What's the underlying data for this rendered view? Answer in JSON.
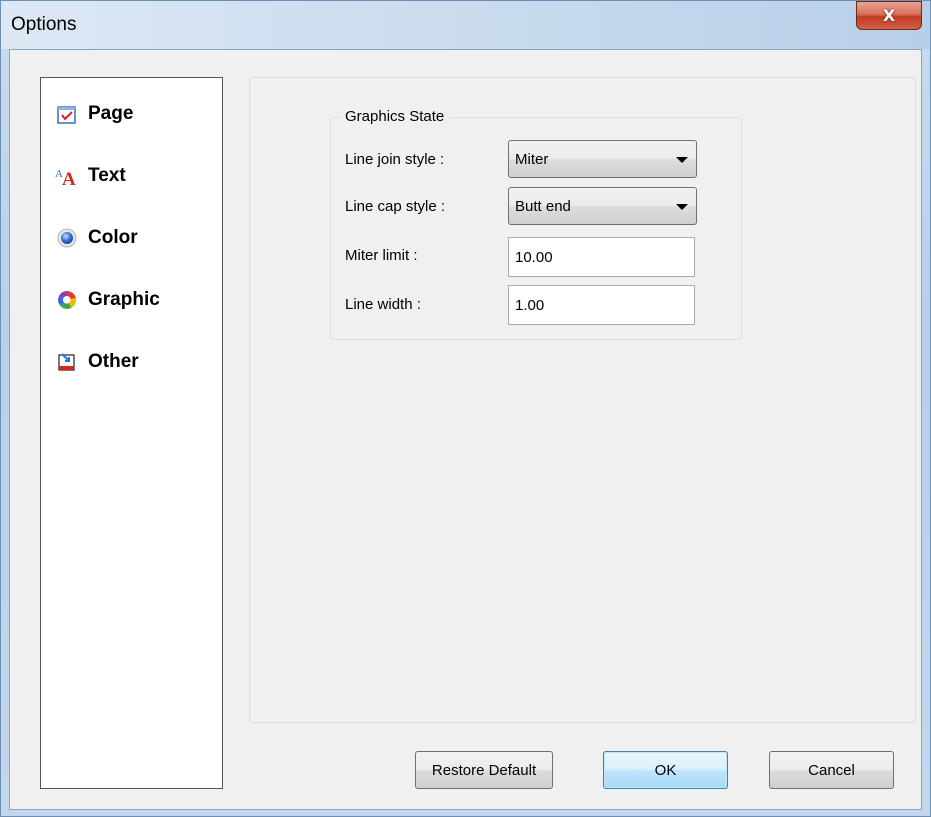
{
  "window": {
    "title": "Options",
    "close_label": "X"
  },
  "sidebar": {
    "items": [
      {
        "label": "Page",
        "icon": "page-icon"
      },
      {
        "label": "Text",
        "icon": "text-icon"
      },
      {
        "label": "Color",
        "icon": "color-icon"
      },
      {
        "label": "Graphic",
        "icon": "graphic-icon"
      },
      {
        "label": "Other",
        "icon": "other-icon"
      }
    ],
    "text_icon_glyph": "A",
    "text_icon_glyph_small": "A"
  },
  "graphics_state": {
    "title": "Graphics State",
    "line_join_label": "Line join style :",
    "line_join_value": "Miter",
    "line_cap_label": "Line cap style :",
    "line_cap_value": "Butt end",
    "miter_limit_label": "Miter limit :",
    "miter_limit_value": "10.00",
    "line_width_label": "Line width :",
    "line_width_value": "1.00"
  },
  "buttons": {
    "restore_default": "Restore Default",
    "ok": "OK",
    "cancel": "Cancel"
  },
  "colors": {
    "titlebar": "#c9dbef",
    "close_button": "#c23b1f",
    "panel_bg": "#f0f0f0",
    "ok_button": "#bee6fd"
  }
}
